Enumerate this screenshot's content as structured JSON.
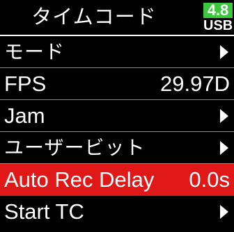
{
  "header": {
    "title": "タイムコード",
    "battery_level": "4.8",
    "battery_source": "USB",
    "battery_color": "#3cc83c"
  },
  "menu": {
    "items": [
      {
        "label": "モード",
        "value": "",
        "has_arrow": true,
        "selected": false
      },
      {
        "label": "FPS",
        "value": "29.97D",
        "has_arrow": false,
        "selected": false
      },
      {
        "label": "Jam",
        "value": "",
        "has_arrow": true,
        "selected": false
      },
      {
        "label": "ユーザービット",
        "value": "",
        "has_arrow": true,
        "selected": false
      },
      {
        "label": "Auto Rec Delay",
        "value": "0.0s",
        "has_arrow": false,
        "selected": true
      },
      {
        "label": "Start TC",
        "value": "",
        "has_arrow": true,
        "selected": false
      }
    ]
  },
  "colors": {
    "background": "#000000",
    "selection": "#e01818",
    "text": "#ffffff",
    "divider": "#8a8a8a"
  }
}
